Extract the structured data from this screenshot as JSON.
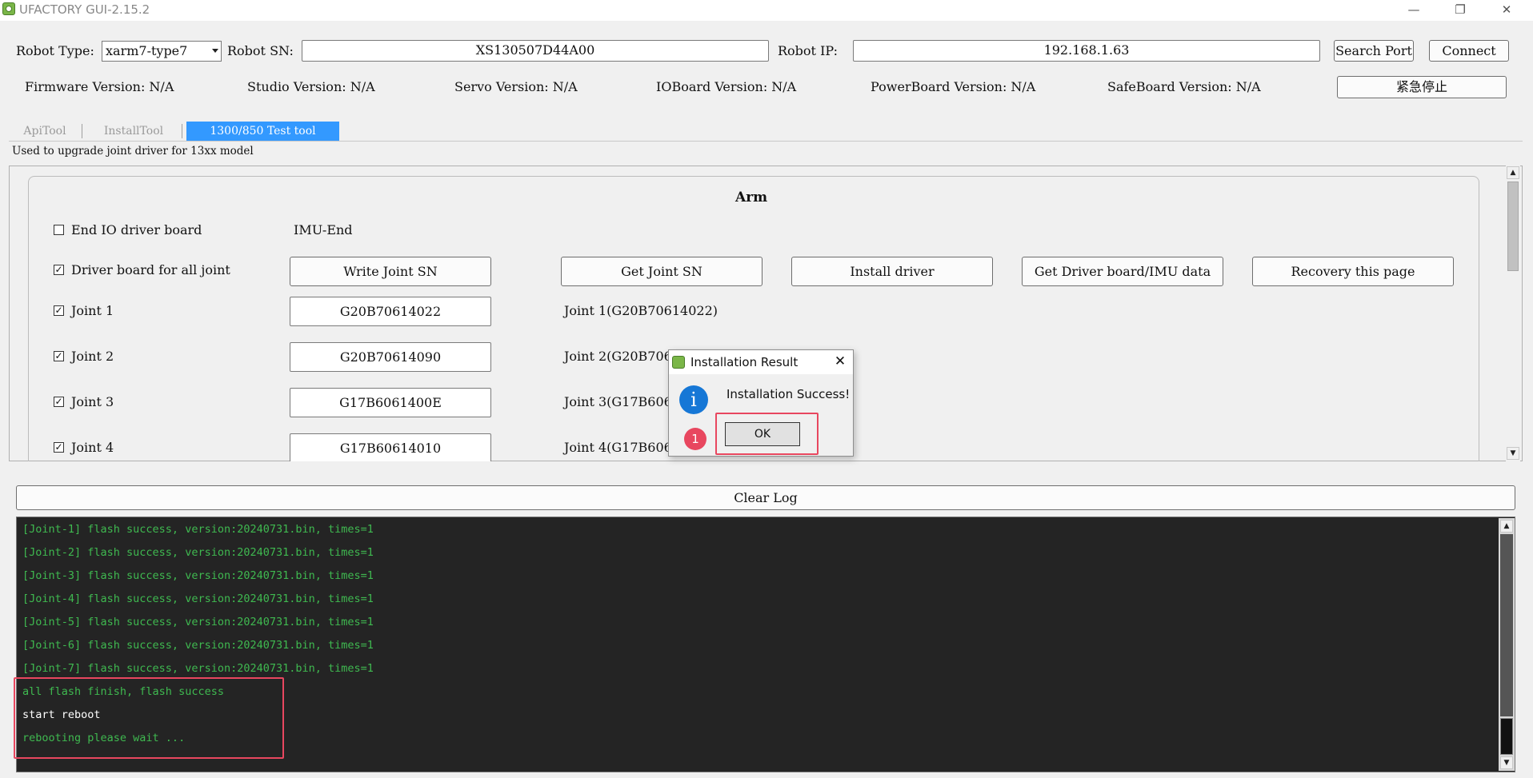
{
  "window": {
    "title": "UFACTORY GUI-2.15.2",
    "minimize": "—",
    "restore": "❐",
    "close": "✕"
  },
  "connection": {
    "robot_type_label": "Robot Type:",
    "robot_type_value": "xarm7-type7",
    "robot_sn_label": "Robot SN:",
    "robot_sn_value": "XS130507D44A00",
    "robot_ip_label": "Robot IP:",
    "robot_ip_value": "192.168.1.63",
    "search_port": "Search Port",
    "connect": "Connect"
  },
  "versions": {
    "firmware": "Firmware Version: N/A",
    "studio": "Studio Version: N/A",
    "servo": "Servo Version: N/A",
    "ioboard": "IOBoard Version: N/A",
    "powerboard": "PowerBoard Version: N/A",
    "safeboard": "SafeBoard Version: N/A",
    "estop": "紧急停止"
  },
  "tabs": [
    {
      "label": "ApiTool",
      "active": false
    },
    {
      "label": "InstallTool",
      "active": false
    },
    {
      "label": "1300/850 Test tool",
      "active": true
    }
  ],
  "description": "Used to upgrade joint driver for 13xx model",
  "arm": {
    "title": "Arm",
    "end_io": {
      "label": "End IO driver board",
      "checked": false
    },
    "imu_end": "IMU-End",
    "all_joint": {
      "label": "Driver board for all joint",
      "checked": true
    },
    "buttons": {
      "write_sn": "Write Joint SN",
      "get_sn": "Get Joint SN",
      "install": "Install driver",
      "get_data": "Get Driver board/IMU data",
      "recovery": "Recovery this page"
    },
    "joints": [
      {
        "label": "Joint 1",
        "checked": true,
        "sn": "G20B70614022",
        "info": "Joint 1(G20B70614022)"
      },
      {
        "label": "Joint 2",
        "checked": true,
        "sn": "G20B70614090",
        "info": "Joint 2(G20B706"
      },
      {
        "label": "Joint 3",
        "checked": true,
        "sn": "G17B6061400E",
        "info": "Joint 3(G17B606"
      },
      {
        "label": "Joint 4",
        "checked": true,
        "sn": "G17B60614010",
        "info": "Joint 4(G17B606"
      }
    ]
  },
  "log": {
    "clear_label": "Clear Log",
    "lines": [
      {
        "text": "[Joint-1] flash success, version:20240731.bin, times=1",
        "color": "#3fb950"
      },
      {
        "text": "[Joint-2] flash success, version:20240731.bin, times=1",
        "color": "#3fb950"
      },
      {
        "text": "[Joint-3] flash success, version:20240731.bin, times=1",
        "color": "#3fb950"
      },
      {
        "text": "[Joint-4] flash success, version:20240731.bin, times=1",
        "color": "#3fb950"
      },
      {
        "text": "[Joint-5] flash success, version:20240731.bin, times=1",
        "color": "#3fb950"
      },
      {
        "text": "[Joint-6] flash success, version:20240731.bin, times=1",
        "color": "#3fb950"
      },
      {
        "text": "[Joint-7] flash success, version:20240731.bin, times=1",
        "color": "#3fb950"
      },
      {
        "text": "all flash finish, flash success",
        "color": "#3fb950"
      },
      {
        "text": "start reboot",
        "color": "#ffffff"
      },
      {
        "text": "rebooting please wait ...",
        "color": "#3fb950"
      }
    ]
  },
  "dialog": {
    "title": "Installation Result",
    "close": "✕",
    "icon": "i",
    "message": "Installation Success!",
    "ok": "OK",
    "step_badge": "1"
  },
  "colors": {
    "accent": "#3399ff",
    "highlight": "#e8475f",
    "log_bg": "#242424",
    "log_green": "#3fb950"
  }
}
